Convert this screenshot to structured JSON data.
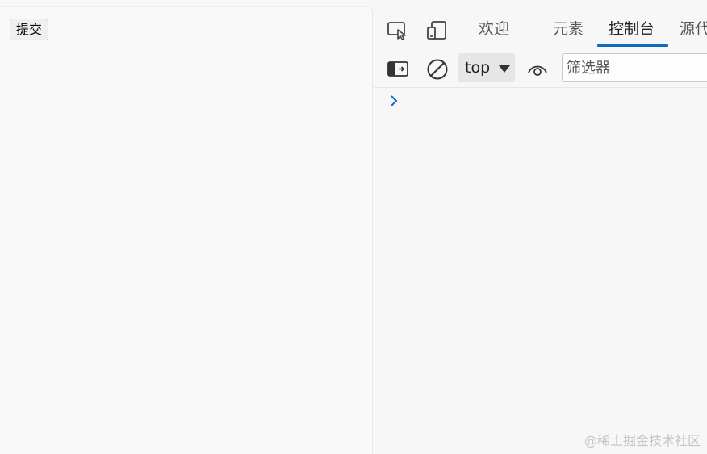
{
  "page": {
    "submit_button_label": "提交"
  },
  "devtools": {
    "tabs": [
      {
        "label": "欢迎",
        "active": false
      },
      {
        "label": "元素",
        "active": false
      },
      {
        "label": "控制台",
        "active": true
      },
      {
        "label": "源代"
      }
    ],
    "toolbar": {
      "context_value": "top",
      "filter_placeholder": "筛选器"
    },
    "console_prompt": ">",
    "accent_color": "#0f6cbd"
  },
  "watermark": "@稀土掘金技术社区",
  "icons": {
    "inspect": "inspect-element-icon",
    "device": "device-emulation-icon",
    "sidebar": "show-console-sidebar-icon",
    "clear": "clear-console-icon",
    "eye": "live-expression-eye-icon",
    "prompt": "chevron-right-icon"
  }
}
